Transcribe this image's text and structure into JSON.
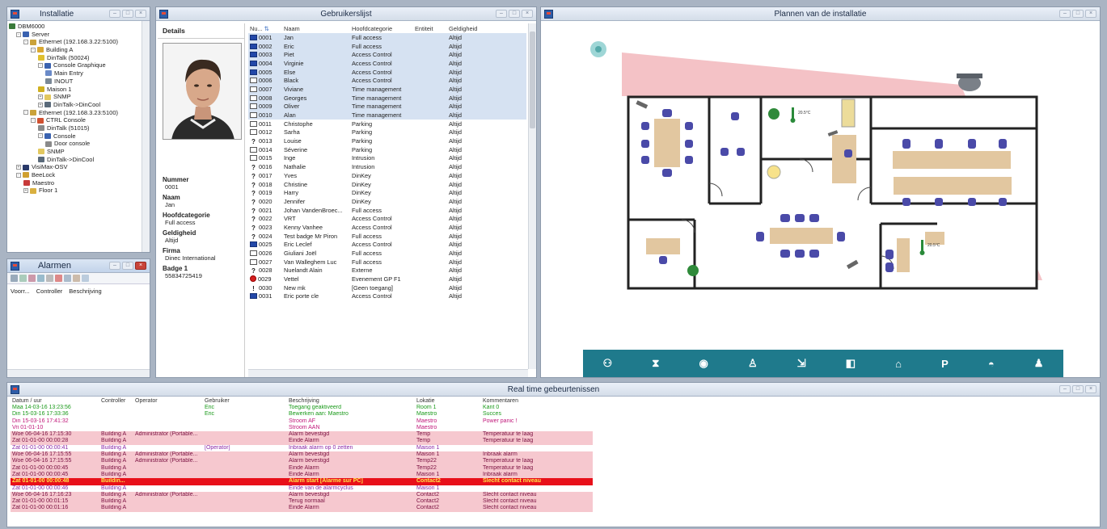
{
  "installatie": {
    "title": "Installatie",
    "tree": [
      {
        "label": "DBM6000",
        "level": 0,
        "icon": "#3a7a3a"
      },
      {
        "label": "Server",
        "level": 1,
        "icon": "#3a62b0",
        "toggle": "-"
      },
      {
        "label": "Ethernet (192.168.3.22:5100)",
        "level": 2,
        "icon": "#caa23a",
        "toggle": "-"
      },
      {
        "label": "Building A",
        "level": 3,
        "icon": "#d9a832",
        "toggle": "-"
      },
      {
        "label": "DinTalk (50024)",
        "level": 4,
        "icon": "#e0c030"
      },
      {
        "label": "Console Graphique",
        "level": 4,
        "icon": "#3a62b0",
        "toggle": "-"
      },
      {
        "label": "Main Entry",
        "level": 5,
        "icon": "#6a8ac8"
      },
      {
        "label": "INOUT",
        "level": 5,
        "icon": "#7a8896"
      },
      {
        "label": "Maison 1",
        "level": 4,
        "icon": "#d0b020"
      },
      {
        "label": "SNMP",
        "level": 4,
        "icon": "#e2c860",
        "toggle": "+"
      },
      {
        "label": "DinTalk->DinCool",
        "level": 4,
        "icon": "#5a6a7a",
        "toggle": "+"
      },
      {
        "label": "Ethernet (192.168.3.23:5100)",
        "level": 2,
        "icon": "#caa23a",
        "toggle": "-"
      },
      {
        "label": "CTRL Console",
        "level": 3,
        "icon": "#d05030",
        "toggle": "-"
      },
      {
        "label": "DinTalk (51015)",
        "level": 4,
        "icon": "#8a8a8a"
      },
      {
        "label": "Console",
        "level": 4,
        "icon": "#3a62b0",
        "toggle": "-"
      },
      {
        "label": "Door console",
        "level": 5,
        "icon": "#8a8a8a"
      },
      {
        "label": "SNMP",
        "level": 4,
        "icon": "#e2c860"
      },
      {
        "label": "DinTalk->DinCool",
        "level": 4,
        "icon": "#5a6a7a"
      },
      {
        "label": "VisiMax-OSV",
        "level": 1,
        "icon": "#2a3a6a",
        "toggle": "+"
      },
      {
        "label": "BeeLock",
        "level": 1,
        "icon": "#d0a030",
        "toggle": "-"
      },
      {
        "label": "Maestro",
        "level": 2,
        "icon": "#c83a3a"
      },
      {
        "label": "Floor 1",
        "level": 2,
        "icon": "#d9b040",
        "toggle": "+"
      }
    ]
  },
  "alarmen": {
    "title": "Alarmen",
    "columns": [
      "Voorr...",
      "Controller",
      "Beschrijving"
    ]
  },
  "gebruikers": {
    "title": "Gebruikerslijst",
    "details_tab": "Details",
    "details": [
      {
        "label": "Nummer",
        "value": "0001"
      },
      {
        "label": "Naam",
        "value": "Jan"
      },
      {
        "label": "Hoofdcategorie",
        "value": "Full access"
      },
      {
        "label": "Geldigheid",
        "value": "Altijd"
      },
      {
        "label": "Firma",
        "value": "Dinec International"
      },
      {
        "label": "Badge 1",
        "value": "55834725419"
      }
    ],
    "columns": [
      "Nu...",
      "Naam",
      "Hoofdcategorie",
      "Entiteit",
      "Geldigheid"
    ],
    "rows": [
      {
        "badge": "card",
        "nr": "0001",
        "naam": "Jan",
        "cat": "Full access",
        "geld": "Altijd"
      },
      {
        "badge": "card",
        "nr": "0002",
        "naam": "Eric",
        "cat": "Full access",
        "geld": "Altijd"
      },
      {
        "badge": "card",
        "nr": "0003",
        "naam": "Piet",
        "cat": "Access Control",
        "geld": "Altijd"
      },
      {
        "badge": "card",
        "nr": "0004",
        "naam": "Virginie",
        "cat": "Access Control",
        "geld": "Altijd"
      },
      {
        "badge": "card",
        "nr": "0005",
        "naam": "Else",
        "cat": "Access Control",
        "geld": "Altijd"
      },
      {
        "badge": "empty",
        "nr": "0006",
        "naam": "Black",
        "cat": "Access Control",
        "geld": "Altijd"
      },
      {
        "badge": "empty",
        "nr": "0007",
        "naam": "Viviane",
        "cat": "Time management",
        "geld": "Altijd"
      },
      {
        "badge": "empty",
        "nr": "0008",
        "naam": "Georges",
        "cat": "Time management",
        "geld": "Altijd"
      },
      {
        "badge": "empty",
        "nr": "0009",
        "naam": "Oliver",
        "cat": "Time management",
        "geld": "Altijd"
      },
      {
        "badge": "empty",
        "nr": "0010",
        "naam": "Alan",
        "cat": "Time management",
        "geld": "Altijd"
      },
      {
        "badge": "empty",
        "nr": "0011",
        "naam": "Christophe",
        "cat": "Parking",
        "geld": "Altijd"
      },
      {
        "badge": "empty",
        "nr": "0012",
        "naam": "Sarha",
        "cat": "Parking",
        "geld": "Altijd"
      },
      {
        "badge": "q",
        "nr": "0013",
        "naam": "Louise",
        "cat": "Parking",
        "geld": "Altijd"
      },
      {
        "badge": "empty",
        "nr": "0014",
        "naam": "Séverine",
        "cat": "Parking",
        "geld": "Altijd"
      },
      {
        "badge": "empty",
        "nr": "0015",
        "naam": "Inge",
        "cat": "Intrusion",
        "geld": "Altijd"
      },
      {
        "badge": "q",
        "nr": "0016",
        "naam": "Nathalie",
        "cat": "Intrusion",
        "geld": "Altijd"
      },
      {
        "badge": "q",
        "nr": "0017",
        "naam": "Yves",
        "cat": "DinKey",
        "geld": "Altijd"
      },
      {
        "badge": "q",
        "nr": "0018",
        "naam": "Christine",
        "cat": "DinKey",
        "geld": "Altijd"
      },
      {
        "badge": "q",
        "nr": "0019",
        "naam": "Harry",
        "cat": "DinKey",
        "geld": "Altijd"
      },
      {
        "badge": "q",
        "nr": "0020",
        "naam": "Jennifer",
        "cat": "DinKey",
        "geld": "Altijd"
      },
      {
        "badge": "q",
        "nr": "0021",
        "naam": "Johan VandenBroec...",
        "cat": "Full access",
        "geld": "Altijd"
      },
      {
        "badge": "q",
        "nr": "0022",
        "naam": "VRT",
        "cat": "Access Control",
        "geld": "Altijd"
      },
      {
        "badge": "q",
        "nr": "0023",
        "naam": "Kenny Vanhee",
        "cat": "Access Control",
        "geld": "Altijd"
      },
      {
        "badge": "q",
        "nr": "0024",
        "naam": "Test badge Mr Piron",
        "cat": "Full access",
        "geld": "Altijd"
      },
      {
        "badge": "card",
        "nr": "0025",
        "naam": "Eric Leclef",
        "cat": "Access Control",
        "geld": "Altijd"
      },
      {
        "badge": "empty",
        "nr": "0026",
        "naam": "Giuliani Joël",
        "cat": "Full access",
        "geld": "Altijd"
      },
      {
        "badge": "empty",
        "nr": "0027",
        "naam": "Van Walleghem Luc",
        "cat": "Full access",
        "geld": "Altijd"
      },
      {
        "badge": "q",
        "nr": "0028",
        "naam": "Nuelandt Alain",
        "cat": "Externe",
        "geld": "Altijd"
      },
      {
        "badge": "stop",
        "nr": "0029",
        "naam": "Vettel",
        "cat": "Evenement GP F1",
        "geld": "Altijd"
      },
      {
        "badge": "excl",
        "nr": "0030",
        "naam": "New mk",
        "cat": "[Geen toegang]",
        "geld": "Altijd"
      },
      {
        "badge": "card",
        "nr": "0031",
        "naam": "Eric porte cle",
        "cat": "Access Control",
        "geld": "Altijd"
      }
    ]
  },
  "plannen": {
    "title": "Plannen van de installatie",
    "temp1": "20.5°C",
    "temp2": "20.5°C",
    "toolbar_icons": [
      "people-icon",
      "hourglass-icon",
      "fingerprint-icon",
      "person-info-icon",
      "door-exit-icon",
      "camera-icon",
      "home-gear-icon",
      "parking-icon",
      "siren-icon",
      "person-walk-icon"
    ]
  },
  "events": {
    "title": "Real time gebeurtenissen",
    "columns": [
      "Datum / uur",
      "Controller",
      "Operator",
      "Gebruiker",
      "Beschrijving",
      "Lokatie",
      "Kommentaren"
    ],
    "rows": [
      {
        "t": "Maa 14-03-16 13:23:56",
        "c": "",
        "o": "",
        "u": "Eric",
        "d": "Toegang geaktiveerd",
        "l": "Room 1",
        "k": "Kant 0",
        "s": "green"
      },
      {
        "t": "Din 15-03-16 17:33:36",
        "c": "",
        "o": "",
        "u": "Eric",
        "d": "Bewerken aan: Maestro",
        "l": "Maestro",
        "k": "Succes",
        "s": "green"
      },
      {
        "t": "Din 15-03-16 17:41:32",
        "c": "",
        "o": "",
        "u": "",
        "d": "Stroom AF",
        "l": "Maestro",
        "k": "Power panic !",
        "s": "magenta"
      },
      {
        "t": "Vri 01-01-10",
        "c": "",
        "o": "",
        "u": "",
        "d": "Stroom AAN",
        "l": "Maestro",
        "k": "",
        "s": "magenta"
      },
      {
        "t": "Woe 06-04-16 17:15:30",
        "c": "Building A",
        "o": "Administrator (Portable...",
        "u": "",
        "d": "Alarm bevestigd",
        "l": "Temp",
        "k": "Temperatuur te laag",
        "s": "pink"
      },
      {
        "t": "Zat 01-01-00 00:00:28",
        "c": "Building A",
        "o": "",
        "u": "",
        "d": "Einde Alarm",
        "l": "Temp",
        "k": "Temperatuur te laag",
        "s": "pink"
      },
      {
        "t": "Zat 01-01-00 00:00:41",
        "c": "Building A",
        "o": "",
        "u": "[Operator]",
        "d": "Inbraak alarm op 0 zetten",
        "l": "Maison 1",
        "k": "",
        "s": "violet"
      },
      {
        "t": "Woe 06-04-16 17:15:55",
        "c": "Building A",
        "o": "Administrator (Portable...",
        "u": "",
        "d": "Alarm bevestigd",
        "l": "Maison 1",
        "k": "Inbraak alarm",
        "s": "pink"
      },
      {
        "t": "Woe 06-04-16 17:15:55",
        "c": "Building A",
        "o": "Administrator (Portable...",
        "u": "",
        "d": "Alarm bevestigd",
        "l": "Temp22",
        "k": "Temperatuur te laag",
        "s": "pink"
      },
      {
        "t": "Zat 01-01-00 00:00:45",
        "c": "Building A",
        "o": "",
        "u": "",
        "d": "Einde Alarm",
        "l": "Temp22",
        "k": "Temperatuur te laag",
        "s": "pink"
      },
      {
        "t": "Zat 01-01-00 00:00:45",
        "c": "Building A",
        "o": "",
        "u": "",
        "d": "Einde Alarm",
        "l": "Maison 1",
        "k": "Inbraak alarm",
        "s": "pink"
      },
      {
        "t": "Zat 01-01-00 00:00:48",
        "c": "Buildin...",
        "o": "",
        "u": "",
        "d": "Alarm start [Alarme sur PC]",
        "l": "Contact2",
        "k": "Slecht contact niveau",
        "s": "red"
      },
      {
        "t": "Zat 01-01-00 00:00:46",
        "c": "Building A",
        "o": "",
        "u": "",
        "d": "Einde van de alarmcyclus",
        "l": "Maison 1",
        "k": "",
        "s": "violet"
      },
      {
        "t": "Woe 06-04-16 17:16:23",
        "c": "Building A",
        "o": "Administrator (Portable...",
        "u": "",
        "d": "Alarm bevestigd",
        "l": "Contact2",
        "k": "Slecht contact niveau",
        "s": "pink"
      },
      {
        "t": "Zat 01-01-00 00:01:15",
        "c": "Building A",
        "o": "",
        "u": "",
        "d": "Terug normaal",
        "l": "Contact2",
        "k": "Slecht contact niveau",
        "s": "pink"
      },
      {
        "t": "Zat 01-01-00 00:01:16",
        "c": "Building A",
        "o": "",
        "u": "",
        "d": "Einde Alarm",
        "l": "Contact2",
        "k": "Slecht contact niveau",
        "s": "pink"
      }
    ]
  },
  "colors": {
    "row_pink": "#f6c8cf",
    "row_red": "#e8101a",
    "text_green": "#1a9a1a",
    "text_magenta": "#c0187a",
    "text_violet": "#8a2aa8",
    "plan_toolbar": "#1f7a8c"
  }
}
